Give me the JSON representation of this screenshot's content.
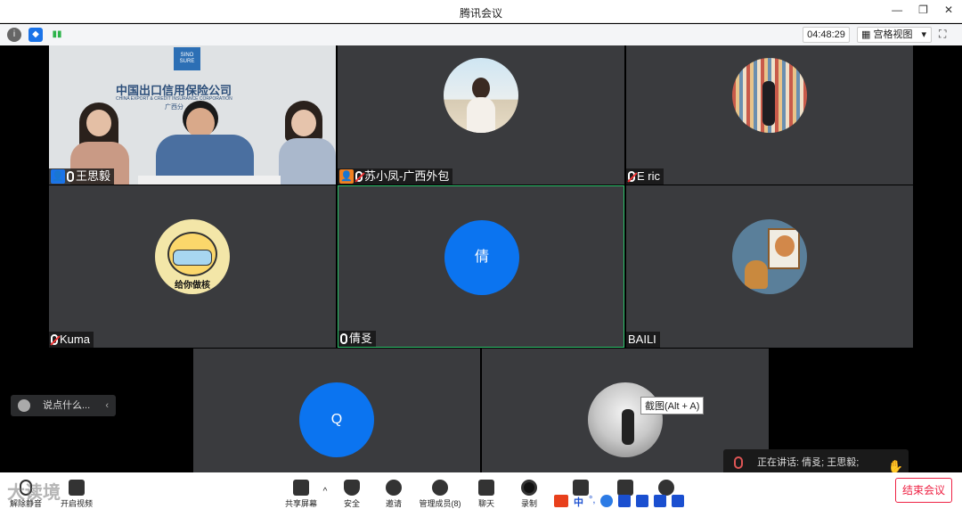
{
  "window": {
    "title": "腾讯会议",
    "min": "—",
    "restore": "❐",
    "close": "✕"
  },
  "toolbar": {
    "clock": "04:48:29",
    "view_label": "宫格视图",
    "view_caret": "▾"
  },
  "participants": [
    {
      "name": "王思毅",
      "mic": "on",
      "host": true,
      "video": true,
      "video_sign_text": "中国出口信用保险公司",
      "video_sign_sub": "CHINA EXPORT & CREDIT INSURANCE CORPORATION",
      "video_sign_branch": "广西分",
      "video_logo_text": "SINO SURE"
    },
    {
      "name": "苏小凤-广西外包",
      "mic": "muted",
      "host": true,
      "avatar": "beach-photo"
    },
    {
      "name": "E ric",
      "mic": "muted",
      "avatar": "bookshelf-photo"
    },
    {
      "name": "Kuma",
      "mic": "muted",
      "avatar": "cartoon-sticker",
      "avatar_text": "给你做核"
    },
    {
      "name": "倩㕛",
      "mic": "on",
      "avatar_letter": "倩",
      "active": true
    },
    {
      "name": "BAILI",
      "mic": "none",
      "avatar": "cat-painting"
    },
    {
      "name": "",
      "avatar_letter": "Q"
    },
    {
      "name": "",
      "avatar": "ink-painting"
    }
  ],
  "chat": {
    "placeholder": "说点什么...",
    "chevron": "‹"
  },
  "speaking": {
    "text": "正在讲话: 倩㕛; 王思毅;"
  },
  "tooltip": {
    "text": "截图(Alt + A)"
  },
  "controls": [
    {
      "label": "解除静音"
    },
    {
      "label": "开启视频"
    },
    {
      "label": "共享屏幕"
    },
    {
      "label": "安全"
    },
    {
      "label": "邀请"
    },
    {
      "label": "管理成员(8)"
    },
    {
      "label": "聊天"
    },
    {
      "label": "录制"
    }
  ],
  "end_button": "结束会议",
  "watermark": "大读境",
  "ime": {
    "zh": "中",
    "dot": "°,"
  },
  "colors": {
    "accent_blue": "#0b74f0",
    "active_border": "#2cc36b",
    "end_red": "#e22244",
    "tile_bg": "#3a3b3e"
  }
}
